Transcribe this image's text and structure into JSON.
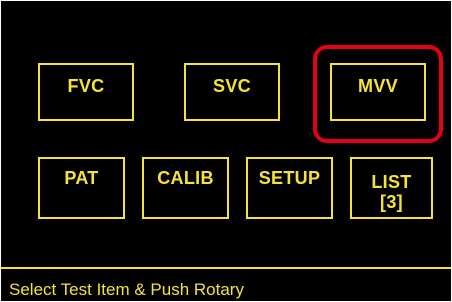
{
  "colors": {
    "background": "#000000",
    "foreground": "#f5e23a",
    "selection_highlight": "#e50015"
  },
  "menu": {
    "row1": [
      {
        "label": "FVC"
      },
      {
        "label": "SVC"
      },
      {
        "label": "MVV",
        "selected": true
      }
    ],
    "row2": [
      {
        "label": "PAT"
      },
      {
        "label": "CALIB"
      },
      {
        "label": "SETUP"
      },
      {
        "label": "LIST",
        "sub_label": "[3]"
      }
    ]
  },
  "status_bar": {
    "message": "Select Test Item & Push Rotary"
  }
}
